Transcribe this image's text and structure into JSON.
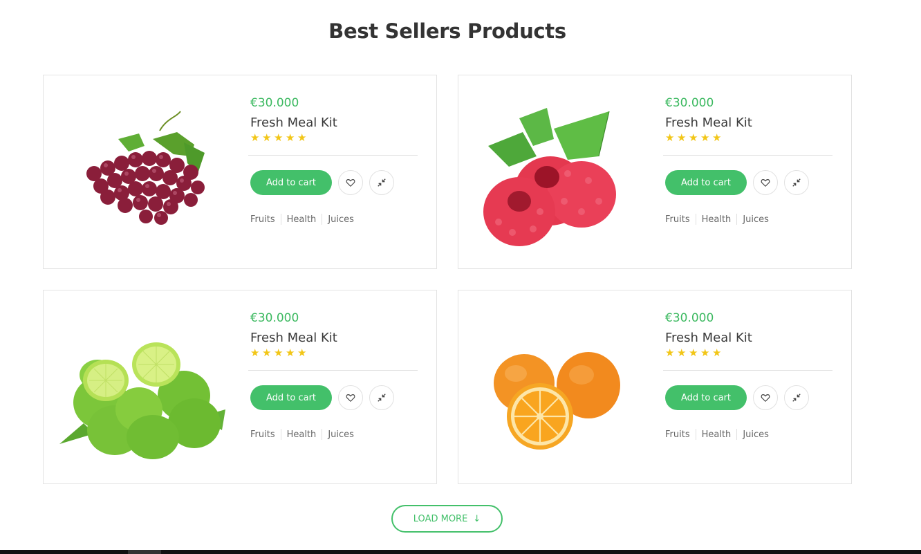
{
  "section": {
    "title": "Best Sellers Products"
  },
  "products": [
    {
      "price": "€30.000",
      "name": "Fresh Meal Kit",
      "image": "grapes",
      "rating": 5
    },
    {
      "price": "€30.000",
      "name": "Fresh Meal Kit",
      "image": "raspberries",
      "rating": 5
    },
    {
      "price": "€30.000",
      "name": "Fresh Meal Kit",
      "image": "limes",
      "rating": 5
    },
    {
      "price": "€30.000",
      "name": "Fresh Meal Kit",
      "image": "oranges",
      "rating": 5
    }
  ],
  "card_labels": {
    "add_to_cart": "Add to cart",
    "tags": [
      "Fruits",
      "Health",
      "Juices"
    ],
    "star": "★"
  },
  "icons": {
    "wishlist": "heart-icon",
    "compare": "compress-icon"
  },
  "load_more": {
    "label": "LOAD MORE",
    "arrow": "↓"
  },
  "colors": {
    "accent": "#43c06a",
    "price": "#3cb960",
    "star": "#f2c617"
  }
}
